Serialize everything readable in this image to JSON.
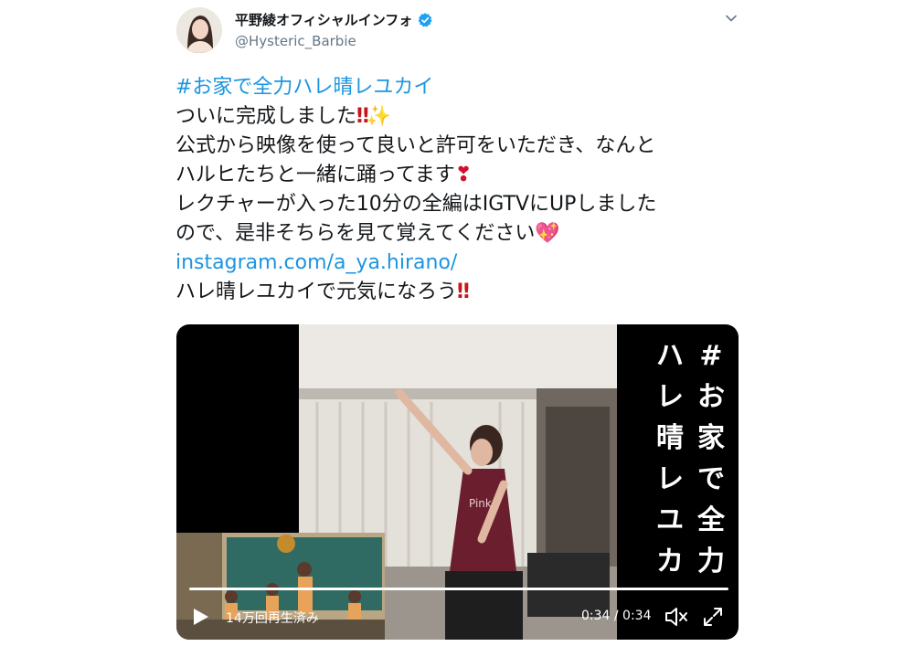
{
  "tweet": {
    "author": {
      "display_name": "平野綾オフィシャルインフォ",
      "handle": "@Hysteric_Barbie",
      "verified": true
    },
    "lines": {
      "hashtag": "#お家で全力ハレ晴レユカイ",
      "l1": "ついに完成しました",
      "l2": "公式から映像を使って良いと許可をいただき、なんと",
      "l3": "ハルヒたちと一緒に踊ってます",
      "l4": "レクチャーが入った10分の全編はIGTVにUPしました",
      "l5": "ので、是非そちらを見て覚えてください",
      "link": "instagram.com/a_ya.hirano/",
      "l6": "ハレ晴レユカイで元気になろう"
    },
    "emoji": {
      "double_exclamation": "‼",
      "sparkles": "✨",
      "heavy_exclamation": "❣",
      "sparkling_heart": "💖"
    }
  },
  "video": {
    "overlay_caption": [
      "#",
      "お",
      "家",
      "で",
      "全",
      "力",
      "ハ",
      "レ",
      "晴",
      "レ",
      "ユ",
      "カ"
    ],
    "views": "14万回再生済み",
    "time": "0:34 / 0:34",
    "progress": 1.0
  },
  "icons": {
    "caret": "chevron-down-icon",
    "verified": "verified-badge-icon",
    "play": "play-icon",
    "volume": "volume-icon",
    "fullscreen": "fullscreen-icon"
  },
  "colors": {
    "link": "#1b95e0",
    "verified": "#1da1f2",
    "handle": "#657786"
  }
}
